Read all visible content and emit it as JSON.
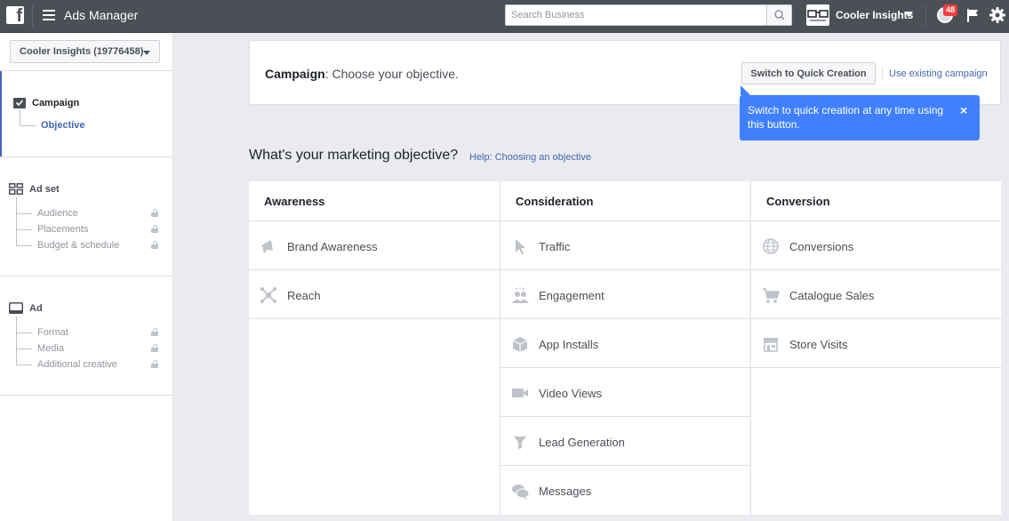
{
  "topbar": {
    "app_title": "Ads Manager",
    "search_placeholder": "Search Business",
    "account_name": "Cooler Insights",
    "notification_count": "48"
  },
  "sidebar": {
    "account_selector": "Cooler Insights (19776458)",
    "campaign": {
      "label": "Campaign",
      "active_item": "Objective"
    },
    "ad_set": {
      "label": "Ad set",
      "items": [
        "Audience",
        "Placements",
        "Budget & schedule"
      ]
    },
    "ad": {
      "label": "Ad",
      "items": [
        "Format",
        "Media",
        "Additional creative"
      ]
    }
  },
  "header": {
    "title_bold": "Campaign",
    "title_rest": ": Choose your objective.",
    "quick_creation_button": "Switch to Quick Creation",
    "existing_campaign_link": "Use existing campaign"
  },
  "tooltip": {
    "text": "Switch to quick creation at any time using this button.",
    "close": "×"
  },
  "objectives": {
    "question": "What's your marketing objective?",
    "help_link": "Help: Choosing an objective",
    "columns": [
      {
        "heading": "Awareness",
        "items": [
          "Brand Awareness",
          "Reach"
        ]
      },
      {
        "heading": "Consideration",
        "items": [
          "Traffic",
          "Engagement",
          "App Installs",
          "Video Views",
          "Lead Generation",
          "Messages"
        ]
      },
      {
        "heading": "Conversion",
        "items": [
          "Conversions",
          "Catalogue Sales",
          "Store Visits"
        ]
      }
    ]
  },
  "colors": {
    "topbar": "#4b4f56",
    "link": "#4267b2",
    "tooltip": "#4080ff",
    "badge": "#fa3e3e"
  }
}
